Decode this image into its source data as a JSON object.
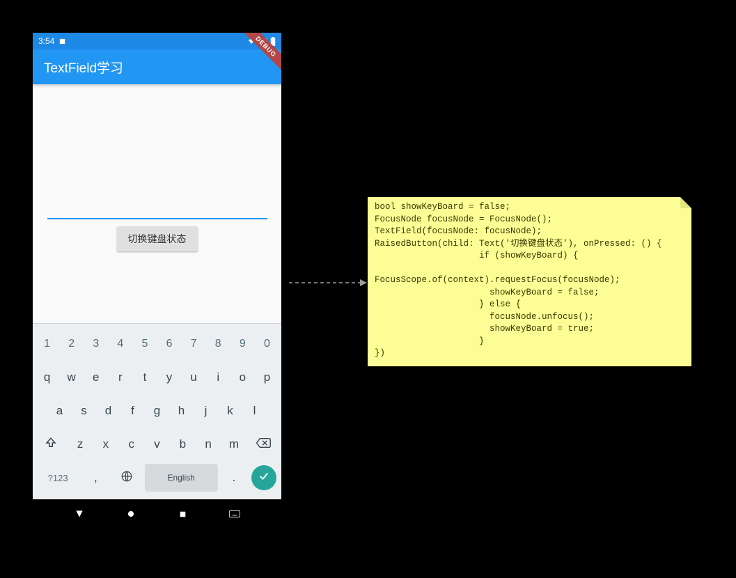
{
  "statusbar": {
    "time": "3:54",
    "debug_label": "DEBUG"
  },
  "appbar": {
    "title": "TextField学习"
  },
  "body": {
    "textfield_value": "",
    "button_label": "切换键盘状态"
  },
  "keyboard": {
    "rows": {
      "numbers": [
        "1",
        "2",
        "3",
        "4",
        "5",
        "6",
        "7",
        "8",
        "9",
        "0"
      ],
      "row1": [
        "q",
        "w",
        "e",
        "r",
        "t",
        "y",
        "u",
        "i",
        "o",
        "p"
      ],
      "row2": [
        "a",
        "s",
        "d",
        "f",
        "g",
        "h",
        "j",
        "k",
        "l"
      ],
      "row3": [
        "z",
        "x",
        "c",
        "v",
        "b",
        "n",
        "m"
      ]
    },
    "sym_label": "?123",
    "comma": ",",
    "period": ".",
    "language_label": "English"
  },
  "note": {
    "code": "bool showKeyBoard = false;\nFocusNode focusNode = FocusNode();\nTextField(focusNode: focusNode);\nRaisedButton(child: Text('切换键盘状态'), onPressed: () {\n                    if (showKeyBoard) {\n\nFocusScope.of(context).requestFocus(focusNode);\n                      showKeyBoard = false;\n                    } else {\n                      focusNode.unfocus();\n                      showKeyBoard = true;\n                    }\n})"
  }
}
